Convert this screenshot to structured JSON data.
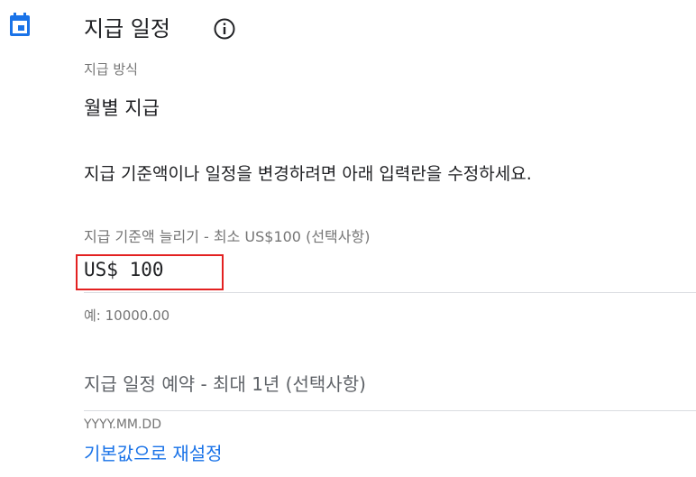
{
  "section": {
    "title": "지급 일정",
    "calendar_icon": "calendar-icon",
    "info_icon": "info-icon",
    "accent_color": "#1a73e8"
  },
  "payment_method": {
    "label": "지급 방식",
    "value": "월별 지급"
  },
  "description": "지급 기준액이나 일정을 변경하려면 아래 입력란을 수정하세요.",
  "threshold": {
    "label": "지급 기준액 늘리기 - 최소 US$100 (선택사항)",
    "value": "US$ 100",
    "hint": "예: 10000.00",
    "highlight_color": "#e32121"
  },
  "schedule": {
    "label": "지급 일정 예약 - 최대 1년 (선택사항)",
    "placeholder": "YYYY.MM.DD",
    "reset_label": "기본값으로 재설정"
  }
}
